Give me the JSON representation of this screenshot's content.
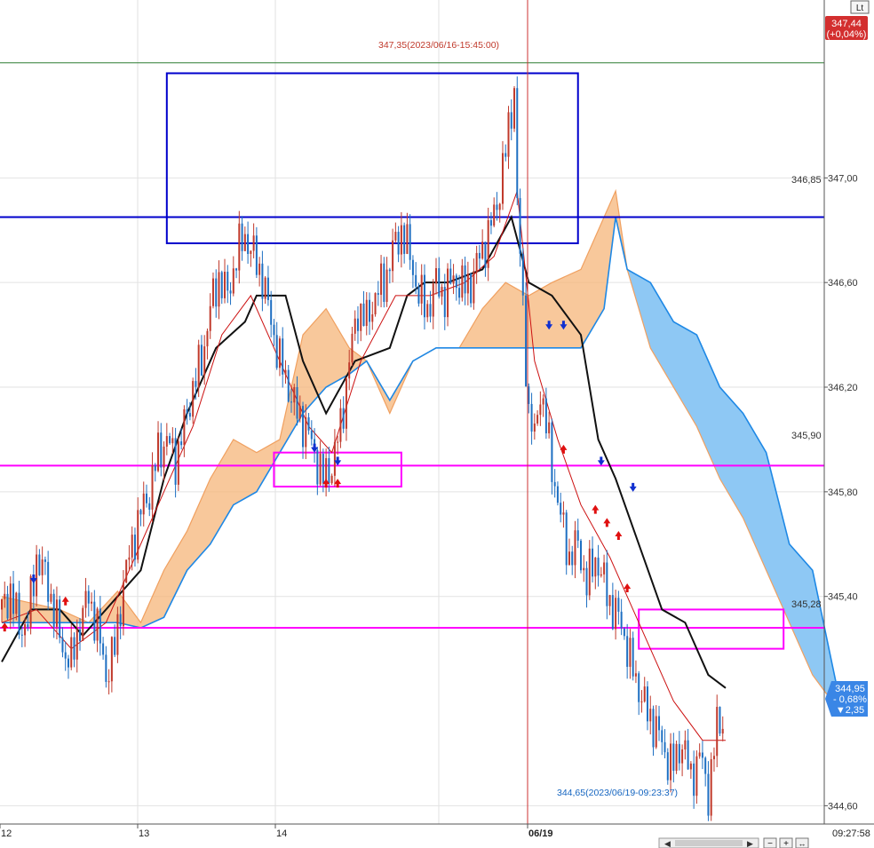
{
  "chart_data": {
    "type": "candlestick",
    "title": "",
    "y_axis": {
      "ylim": [
        344.53,
        347.68
      ],
      "ticks": [
        "347,00",
        "346,60",
        "346,20",
        "345,80",
        "345,40",
        "344,60"
      ],
      "position": "right"
    },
    "x_axis": {
      "ticks": [
        "12",
        "13",
        "14",
        "06/19"
      ],
      "current_time": "09:27:58"
    },
    "horizontal_lines": [
      {
        "value": 347.44,
        "color": "#2e7d32"
      },
      {
        "value": 346.85,
        "label": "346,85",
        "color": "#0000cc"
      },
      {
        "value": 345.9,
        "label": "345,90",
        "color": "#ff00ff"
      },
      {
        "value": 345.28,
        "label": "345,28",
        "color": "#ff00ff"
      }
    ],
    "annotations": {
      "high": "347,35(2023/06/16-15:45:00)",
      "low": "344,65(2023/06/19-09:23:37)"
    },
    "last_price_badge": {
      "price": "347,44",
      "change": "(+0,04%)",
      "color": "#d32f2f"
    },
    "current_price_badge": {
      "price": "344,95",
      "change": "- 0,68%",
      "diff": "▼2,35",
      "color": "#3a86e6"
    },
    "price_path": [
      [
        0,
        345.35
      ],
      [
        3,
        345.42
      ],
      [
        6,
        345.28
      ],
      [
        9,
        345.3
      ],
      [
        12,
        345.55
      ],
      [
        15,
        345.48
      ],
      [
        18,
        345.35
      ],
      [
        21,
        345.2
      ],
      [
        24,
        345.15
      ],
      [
        27,
        345.3
      ],
      [
        30,
        345.4
      ],
      [
        33,
        345.28
      ],
      [
        36,
        345.1
      ],
      [
        39,
        345.2
      ],
      [
        42,
        345.45
      ],
      [
        45,
        345.6
      ],
      [
        48,
        345.72
      ],
      [
        51,
        345.8
      ],
      [
        54,
        345.95
      ],
      [
        57,
        346.0
      ],
      [
        60,
        345.92
      ],
      [
        63,
        346.05
      ],
      [
        66,
        346.2
      ],
      [
        69,
        346.3
      ],
      [
        72,
        346.5
      ],
      [
        75,
        346.62
      ],
      [
        78,
        346.55
      ],
      [
        81,
        346.7
      ],
      [
        84,
        346.78
      ],
      [
        87,
        346.7
      ],
      [
        90,
        346.62
      ],
      [
        93,
        346.45
      ],
      [
        96,
        346.3
      ],
      [
        99,
        346.2
      ],
      [
        102,
        346.1
      ],
      [
        105,
        346.05
      ],
      [
        108,
        345.95
      ],
      [
        111,
        345.85
      ],
      [
        114,
        345.9
      ],
      [
        117,
        346.05
      ],
      [
        120,
        346.3
      ],
      [
        123,
        346.5
      ],
      [
        126,
        346.45
      ],
      [
        129,
        346.55
      ],
      [
        132,
        346.6
      ],
      [
        135,
        346.72
      ],
      [
        138,
        346.8
      ],
      [
        141,
        346.7
      ],
      [
        144,
        346.55
      ],
      [
        147,
        346.5
      ],
      [
        150,
        346.6
      ],
      [
        153,
        346.55
      ],
      [
        156,
        346.62
      ],
      [
        159,
        346.58
      ],
      [
        162,
        346.6
      ],
      [
        165,
        346.7
      ],
      [
        168,
        346.78
      ],
      [
        171,
        346.9
      ],
      [
        174,
        347.1
      ],
      [
        177,
        347.35
      ],
      [
        178,
        346.9
      ],
      [
        180,
        346.5
      ],
      [
        182,
        346.1
      ],
      [
        184,
        346.0
      ],
      [
        186,
        346.2
      ],
      [
        188,
        346.05
      ],
      [
        190,
        345.9
      ],
      [
        193,
        345.7
      ],
      [
        196,
        345.55
      ],
      [
        199,
        345.6
      ],
      [
        202,
        345.45
      ],
      [
        205,
        345.55
      ],
      [
        208,
        345.45
      ],
      [
        211,
        345.35
      ],
      [
        214,
        345.3
      ],
      [
        217,
        345.15
      ],
      [
        220,
        345.05
      ],
      [
        223,
        344.95
      ],
      [
        226,
        344.9
      ],
      [
        229,
        344.8
      ],
      [
        232,
        344.75
      ],
      [
        235,
        344.85
      ],
      [
        238,
        344.7
      ],
      [
        241,
        344.8
      ],
      [
        244,
        344.65
      ],
      [
        247,
        344.9
      ],
      [
        250,
        344.95
      ]
    ],
    "kijun_line": [
      [
        0,
        345.15
      ],
      [
        10,
        345.35
      ],
      [
        20,
        345.35
      ],
      [
        28,
        345.25
      ],
      [
        40,
        345.4
      ],
      [
        48,
        345.5
      ],
      [
        56,
        345.85
      ],
      [
        64,
        346.1
      ],
      [
        74,
        346.35
      ],
      [
        84,
        346.45
      ],
      [
        88,
        346.55
      ],
      [
        98,
        346.55
      ],
      [
        104,
        346.3
      ],
      [
        112,
        346.1
      ],
      [
        122,
        346.3
      ],
      [
        134,
        346.35
      ],
      [
        140,
        346.55
      ],
      [
        146,
        346.6
      ],
      [
        154,
        346.6
      ],
      [
        166,
        346.65
      ],
      [
        176,
        346.85
      ],
      [
        182,
        346.6
      ],
      [
        190,
        346.55
      ],
      [
        200,
        346.4
      ],
      [
        206,
        346.0
      ],
      [
        212,
        345.85
      ],
      [
        220,
        345.6
      ],
      [
        228,
        345.35
      ],
      [
        236,
        345.3
      ],
      [
        244,
        345.1
      ],
      [
        250,
        345.05
      ]
    ],
    "tenkan_line": [
      [
        0,
        345.3
      ],
      [
        12,
        345.35
      ],
      [
        24,
        345.2
      ],
      [
        36,
        345.3
      ],
      [
        46,
        345.55
      ],
      [
        56,
        345.8
      ],
      [
        66,
        346.05
      ],
      [
        76,
        346.4
      ],
      [
        86,
        346.55
      ],
      [
        96,
        346.3
      ],
      [
        106,
        346.05
      ],
      [
        114,
        345.95
      ],
      [
        124,
        346.3
      ],
      [
        136,
        346.55
      ],
      [
        148,
        346.55
      ],
      [
        160,
        346.6
      ],
      [
        170,
        346.7
      ],
      [
        178,
        346.95
      ],
      [
        184,
        346.3
      ],
      [
        192,
        346.0
      ],
      [
        200,
        345.75
      ],
      [
        210,
        345.55
      ],
      [
        220,
        345.3
      ],
      [
        232,
        345.0
      ],
      [
        242,
        344.85
      ],
      [
        250,
        344.85
      ]
    ],
    "senkou_a": [
      [
        0,
        345.4
      ],
      [
        20,
        345.35
      ],
      [
        30,
        345.3
      ],
      [
        40,
        345.42
      ],
      [
        48,
        345.3
      ],
      [
        56,
        345.5
      ],
      [
        64,
        345.65
      ],
      [
        72,
        345.85
      ],
      [
        80,
        346.0
      ],
      [
        88,
        345.95
      ],
      [
        96,
        346.0
      ],
      [
        104,
        346.4
      ],
      [
        112,
        346.5
      ],
      [
        120,
        346.35
      ],
      [
        126,
        346.3
      ],
      [
        134,
        346.1
      ],
      [
        142,
        346.3
      ],
      [
        150,
        346.35
      ],
      [
        158,
        346.35
      ],
      [
        166,
        346.5
      ],
      [
        174,
        346.6
      ],
      [
        182,
        346.55
      ],
      [
        190,
        346.6
      ],
      [
        200,
        346.65
      ],
      [
        208,
        346.85
      ],
      [
        212,
        346.95
      ],
      [
        216,
        346.65
      ],
      [
        224,
        346.35
      ],
      [
        232,
        346.2
      ],
      [
        240,
        346.05
      ],
      [
        248,
        345.85
      ],
      [
        256,
        345.7
      ],
      [
        264,
        345.5
      ],
      [
        272,
        345.3
      ],
      [
        280,
        345.1
      ],
      [
        290,
        344.95
      ]
    ],
    "senkou_b": [
      [
        0,
        345.3
      ],
      [
        20,
        345.3
      ],
      [
        30,
        345.3
      ],
      [
        40,
        345.3
      ],
      [
        48,
        345.28
      ],
      [
        56,
        345.32
      ],
      [
        64,
        345.5
      ],
      [
        72,
        345.6
      ],
      [
        80,
        345.75
      ],
      [
        88,
        345.8
      ],
      [
        96,
        345.95
      ],
      [
        104,
        346.1
      ],
      [
        112,
        346.2
      ],
      [
        120,
        346.25
      ],
      [
        126,
        346.3
      ],
      [
        134,
        346.15
      ],
      [
        142,
        346.3
      ],
      [
        150,
        346.35
      ],
      [
        158,
        346.35
      ],
      [
        166,
        346.35
      ],
      [
        174,
        346.35
      ],
      [
        182,
        346.35
      ],
      [
        190,
        346.35
      ],
      [
        200,
        346.35
      ],
      [
        208,
        346.5
      ],
      [
        212,
        346.85
      ],
      [
        216,
        346.65
      ],
      [
        224,
        346.6
      ],
      [
        232,
        346.45
      ],
      [
        240,
        346.4
      ],
      [
        248,
        346.2
      ],
      [
        256,
        346.1
      ],
      [
        264,
        345.95
      ],
      [
        272,
        345.6
      ],
      [
        280,
        345.5
      ],
      [
        290,
        344.97
      ]
    ],
    "signals": {
      "sell": [
        [
          11,
          345.45
        ],
        [
          108,
          345.95
        ],
        [
          116,
          345.9
        ],
        [
          189,
          346.42
        ],
        [
          194,
          346.42
        ],
        [
          207,
          345.9
        ],
        [
          218,
          345.8
        ]
      ],
      "buy": [
        [
          1,
          345.3
        ],
        [
          22,
          345.4
        ],
        [
          112,
          345.85
        ],
        [
          116,
          345.85
        ],
        [
          194,
          345.98
        ],
        [
          205,
          345.75
        ],
        [
          209,
          345.7
        ],
        [
          213,
          345.65
        ],
        [
          216,
          345.45
        ]
      ]
    },
    "boxes": [
      {
        "x0": 57,
        "y0": 346.75,
        "x1": 199,
        "y1": 347.4,
        "color": "#0000cc"
      },
      {
        "x0": 94,
        "y0": 345.82,
        "x1": 138,
        "y1": 345.95,
        "color": "#ff00ff"
      },
      {
        "x0": 220,
        "y0": 345.2,
        "x1": 270,
        "y1": 345.35,
        "color": "#ff00ff"
      }
    ]
  },
  "toolbar": {
    "scroll_left": "◀",
    "scroll_right": "▶",
    "zoom_minus": "−",
    "zoom_plus": "+",
    "zoom_reset": "↔",
    "top_button": "Lt"
  }
}
